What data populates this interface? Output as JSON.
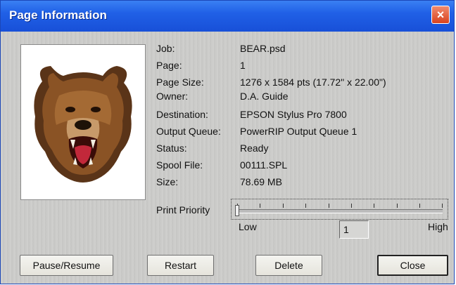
{
  "window": {
    "title": "Page Information",
    "close_glyph": "×"
  },
  "preview": {
    "image": "grizzly-bear-illustration"
  },
  "info": {
    "rows": [
      {
        "label": "Job:",
        "value": "BEAR.psd"
      },
      {
        "label": "Page:",
        "value": "1"
      },
      {
        "label": "Page Size:",
        "value": "1276 x 1584 pts (17.72\" x 22.00\")"
      },
      {
        "label": "Owner:",
        "value": "D.A. Guide"
      },
      {
        "label": "Destination:",
        "value": "EPSON Stylus Pro 7800"
      },
      {
        "label": "Output Queue:",
        "value": "PowerRIP Output Queue 1"
      },
      {
        "label": "Status:",
        "value": "Ready"
      },
      {
        "label": "Spool File:",
        "value": "00111.SPL"
      },
      {
        "label": "Size:",
        "value": "78.69 MB"
      }
    ]
  },
  "priority": {
    "label": "Print Priority",
    "low_label": "Low",
    "high_label": "High",
    "value": "1",
    "min": 1,
    "max": 10
  },
  "buttons": {
    "pause_resume": "Pause/Resume",
    "restart": "Restart",
    "delete": "Delete",
    "close": "Close"
  }
}
